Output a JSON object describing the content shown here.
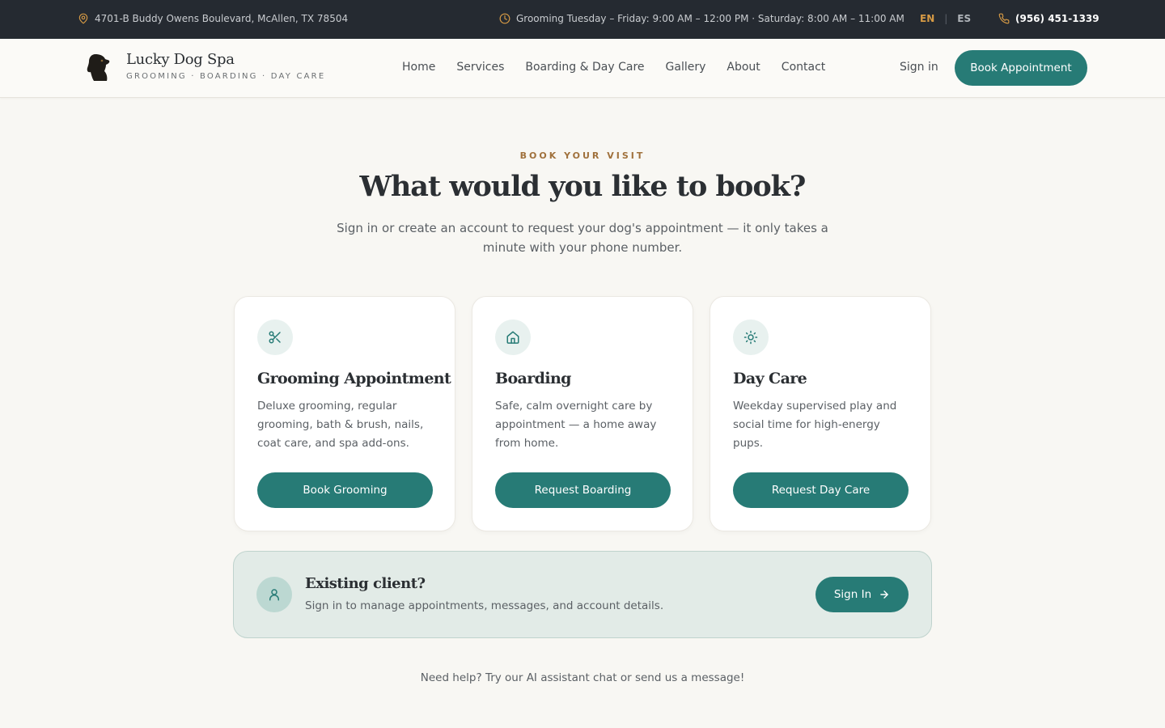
{
  "topbar": {
    "address": "4701-B Buddy Owens Boulevard, McAllen, TX 78504",
    "hours": "Grooming Tuesday – Friday: 9:00 AM – 12:00 PM · Saturday: 8:00 AM – 11:00 AM",
    "lang_en": "EN",
    "lang_sep": "|",
    "lang_es": "ES",
    "phone": "(956) 451-1339",
    "icons": [
      "map-pin-icon",
      "clock-icon",
      "phone-icon"
    ]
  },
  "header": {
    "brand_name": "Lucky Dog Spa",
    "brand_tagline": "GROOMING · BOARDING · DAY CARE",
    "nav": [
      "Home",
      "Services",
      "Boarding & Day Care",
      "Gallery",
      "About",
      "Contact"
    ],
    "sign_in": "Sign in",
    "book_button": "Book Appointment"
  },
  "hero": {
    "eyebrow": "BOOK YOUR VISIT",
    "title": "What would you like to book?",
    "subtitle": "Sign in or create an account to request your dog's appointment — it only takes a minute with your phone number."
  },
  "cards": [
    {
      "icon": "scissors-icon",
      "title": "Grooming Appointment",
      "description": "Deluxe grooming, regular grooming, bath & brush, nails, coat care, and spa add-ons.",
      "button": "Book Grooming"
    },
    {
      "icon": "home-icon",
      "title": "Boarding",
      "description": "Safe, calm overnight care by appointment — a home away from home.",
      "button": "Request Boarding"
    },
    {
      "icon": "sun-icon",
      "title": "Day Care",
      "description": "Weekday supervised play and social time for high-energy pups.",
      "button": "Request Day Care"
    }
  ],
  "existing_client": {
    "icon": "user-icon",
    "title": "Existing client?",
    "description": "Sign in to manage appointments, messages, and account details.",
    "button": "Sign In"
  },
  "footer_help": "Need help? Try our AI assistant chat or send us a message!",
  "colors": {
    "topbar_bg": "#252a31",
    "accent_teal": "#277b76",
    "accent_gold": "#d69a45",
    "eyebrow": "#a0713c",
    "page_bg": "#f8f7f3"
  }
}
